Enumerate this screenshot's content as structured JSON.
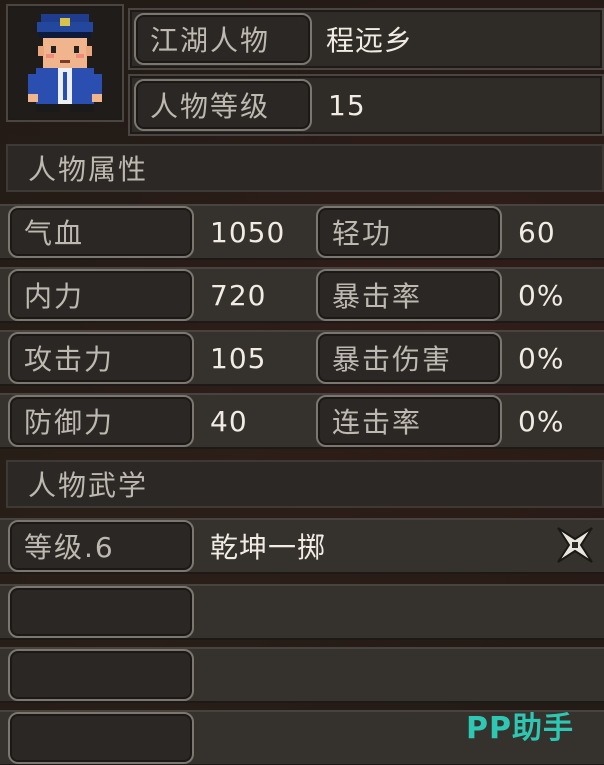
{
  "profile": {
    "name_label": "江湖人物",
    "name_value": "程远乡",
    "level_label": "人物等级",
    "level_value": "15"
  },
  "attributes": {
    "section_title": "人物属性",
    "rows": [
      {
        "left_label": "气血",
        "left_value": "1050",
        "right_label": "轻功",
        "right_value": "60"
      },
      {
        "left_label": "内力",
        "left_value": "720",
        "right_label": "暴击率",
        "right_value": "0%"
      },
      {
        "left_label": "攻击力",
        "left_value": "105",
        "right_label": "暴击伤害",
        "right_value": "0%"
      },
      {
        "left_label": "防御力",
        "left_value": "40",
        "right_label": "连击率",
        "right_value": "0%"
      }
    ]
  },
  "martial": {
    "section_title": "人物武学",
    "skill_level_label": "等级.6",
    "skill_name": "乾坤一掷",
    "skill_icon": "shuriken-icon"
  },
  "watermark": "PP助手",
  "colors": {
    "background": "#231b16",
    "panel": "#2f2b27",
    "label_border": "#7b7670",
    "watermark": "#2ec7b3"
  }
}
